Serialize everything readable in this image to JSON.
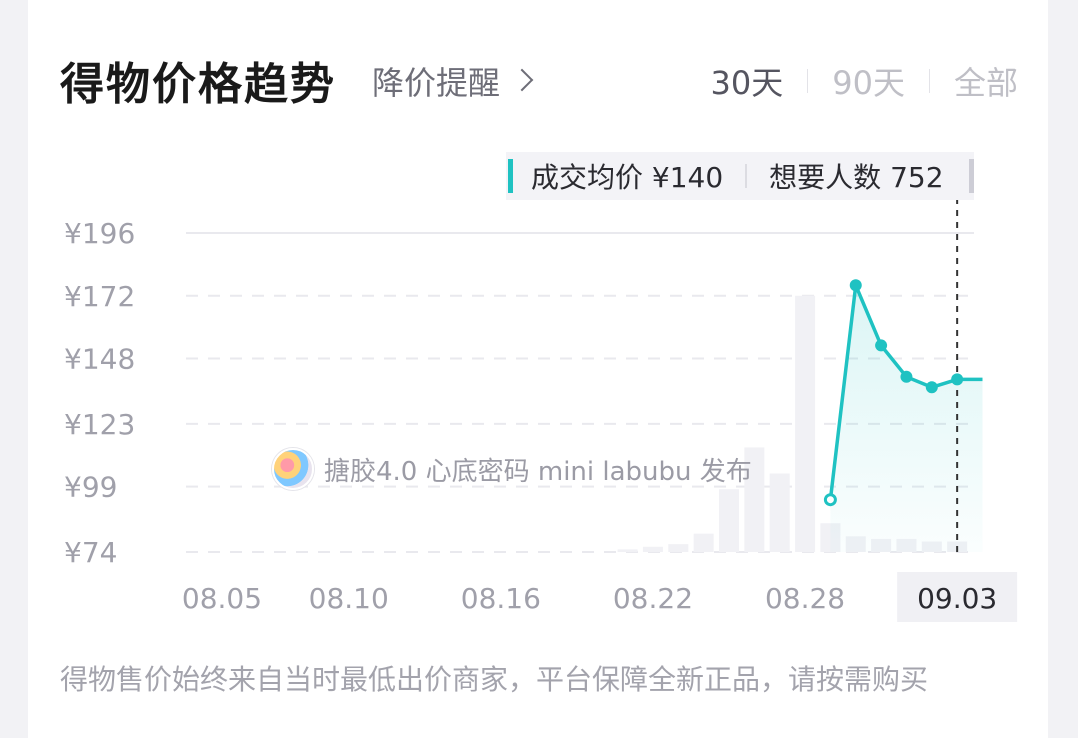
{
  "header": {
    "title": "得物价格趋势",
    "reminder_label": "降价提醒",
    "range_tabs": [
      {
        "label": "30天",
        "active": true
      },
      {
        "label": "90天",
        "active": false
      },
      {
        "label": "全部",
        "active": false
      }
    ]
  },
  "tooltip": {
    "avg_price": "成交均价 ¥140",
    "want_count": "想要人数 752"
  },
  "event": {
    "text": "搪胶4.0 心底密码 mini labubu 发布"
  },
  "footnote": "得物售价始终来自当时最低出价商家，平台保障全新正品，请按需购买",
  "colors": {
    "accent": "#1fc2c2",
    "volume_bar": "#f1f1f5",
    "selected_tick_bg": "#f0f0f4"
  },
  "chart_data": {
    "type": "line",
    "y_ticks": [
      74,
      99,
      123,
      148,
      172,
      196
    ],
    "y_tick_labels": [
      "¥74",
      "¥99",
      "¥123",
      "¥148",
      "¥172",
      "¥196"
    ],
    "ylim": [
      74,
      196
    ],
    "x_tick_labels": [
      "08.05",
      "08.10",
      "08.16",
      "08.22",
      "08.28",
      "09.03"
    ],
    "selected_tick": "09.03",
    "x": [
      "08.29",
      "08.30",
      "08.31",
      "09.01",
      "09.02",
      "09.03",
      "09.04"
    ],
    "series": [
      {
        "values": [
          94,
          176,
          153,
          141,
          137,
          140,
          140
        ]
      }
    ],
    "volume_bars": [
      {
        "x": "08.21",
        "value": 75
      },
      {
        "x": "08.22",
        "value": 76
      },
      {
        "x": "08.23",
        "value": 77
      },
      {
        "x": "08.24",
        "value": 81
      },
      {
        "x": "08.25",
        "value": 98
      },
      {
        "x": "08.26",
        "value": 114
      },
      {
        "x": "08.27",
        "value": 104
      },
      {
        "x": "08.28",
        "value": 172
      },
      {
        "x": "08.29",
        "value": 85
      },
      {
        "x": "08.30",
        "value": 80
      },
      {
        "x": "08.31",
        "value": 79
      },
      {
        "x": "09.01",
        "value": 79
      },
      {
        "x": "09.02",
        "value": 78
      },
      {
        "x": "09.03",
        "value": 78
      }
    ],
    "grid": true
  }
}
